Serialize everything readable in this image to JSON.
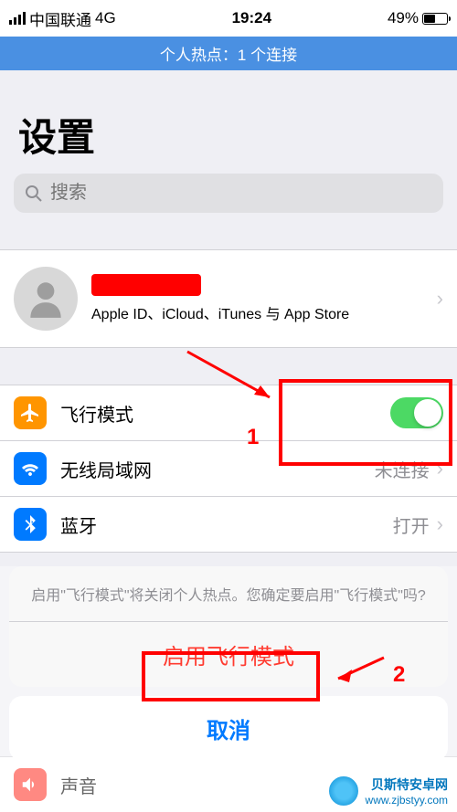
{
  "status_bar": {
    "carrier": "中国联通",
    "network": "4G",
    "time": "19:24",
    "battery_percent": "49%"
  },
  "hotspot": {
    "message": "个人热点：1 个连接"
  },
  "page": {
    "title": "设置"
  },
  "search": {
    "placeholder": "搜索"
  },
  "account": {
    "subtitle": "Apple ID、iCloud、iTunes 与 App Store"
  },
  "settings": {
    "airplane": {
      "label": "飞行模式",
      "enabled": true
    },
    "wifi": {
      "label": "无线局域网",
      "value": "未连接"
    },
    "bluetooth": {
      "label": "蓝牙",
      "value": "打开"
    },
    "sound": {
      "label": "声音"
    }
  },
  "action_sheet": {
    "message": "启用\"飞行模式\"将关闭个人热点。您确定要启用\"飞行模式\"吗?",
    "confirm": "启用飞行模式",
    "cancel": "取消"
  },
  "annotations": {
    "label1": "1",
    "label2": "2"
  },
  "watermark": {
    "name": "贝斯特安卓网",
    "url": "www.zjbstyy.com"
  }
}
